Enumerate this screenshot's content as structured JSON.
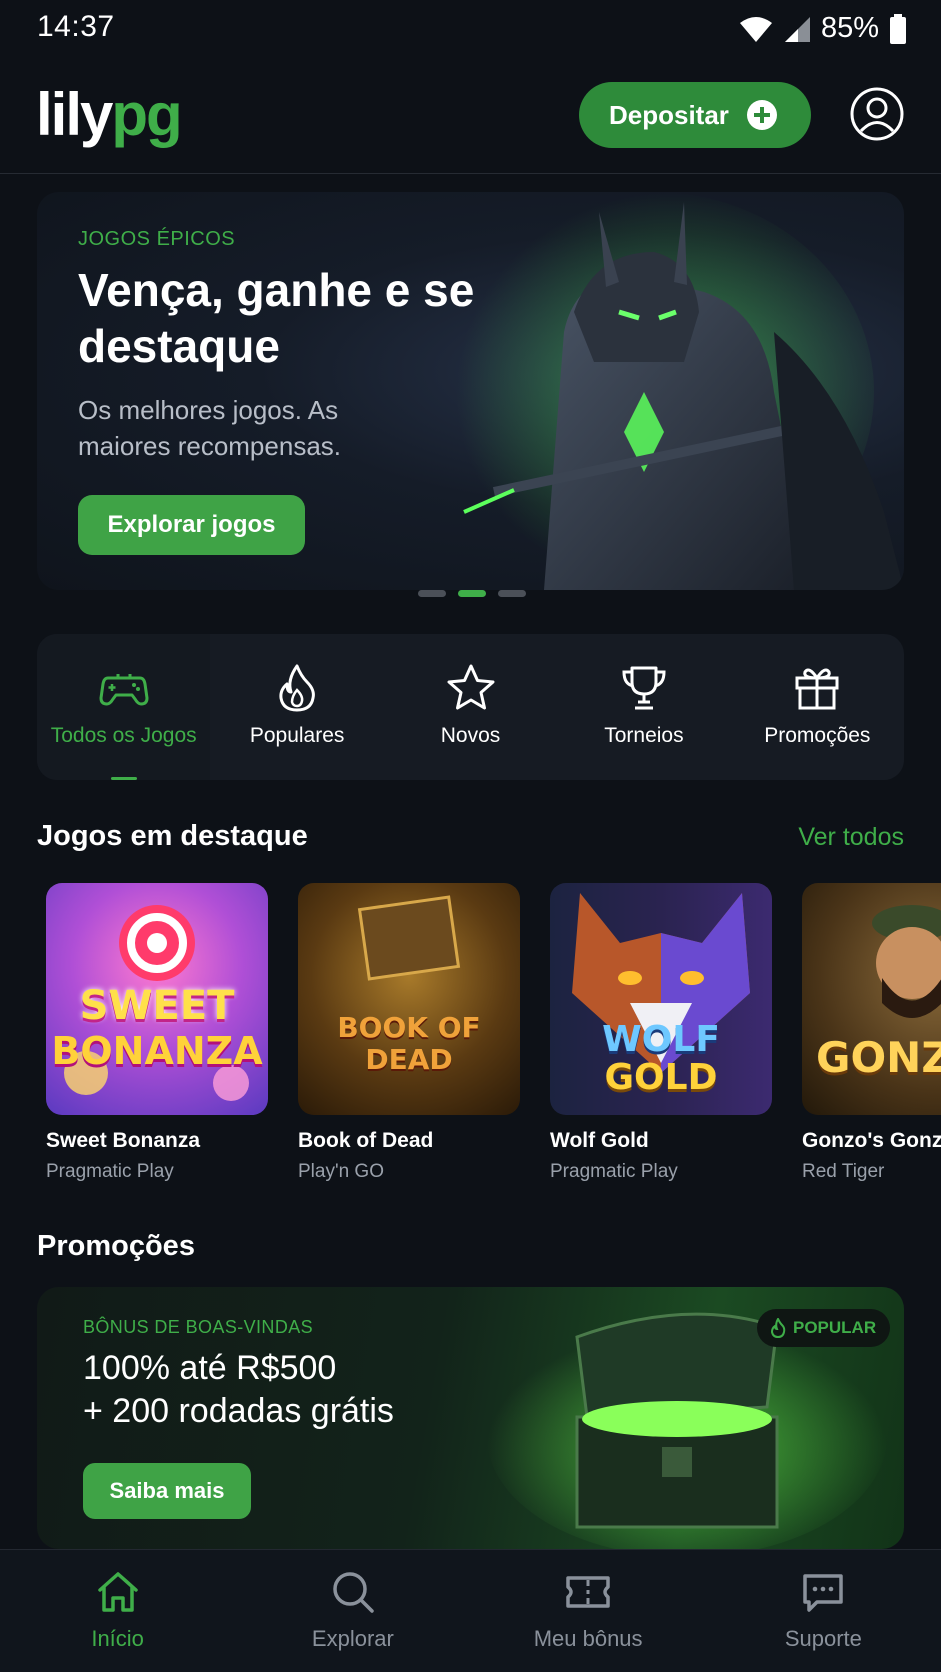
{
  "status_bar": {
    "time": "14:37",
    "battery": "85%"
  },
  "header": {
    "logo_part1": "lily",
    "logo_part2": "pg",
    "deposit_label": "Depositar"
  },
  "hero": {
    "kicker": "JOGOS ÉPICOS",
    "title": "Vença, ganhe e se destaque",
    "subtitle": "Os melhores jogos. As maiores recompensas.",
    "cta": "Explorar jogos",
    "active_slide": 2,
    "slide_count": 3
  },
  "categories": [
    {
      "label": "Todos os Jogos",
      "icon": "gamepad-icon",
      "active": true
    },
    {
      "label": "Populares",
      "icon": "flame-icon",
      "active": false
    },
    {
      "label": "Novos",
      "icon": "star-icon",
      "active": false
    },
    {
      "label": "Torneios",
      "icon": "trophy-icon",
      "active": false
    },
    {
      "label": "Promoções",
      "icon": "gift-icon",
      "active": false
    }
  ],
  "featured": {
    "title": "Jogos em destaque",
    "see_all": "Ver todos",
    "games": [
      {
        "name": "Sweet Bonanza",
        "provider": "Pragmatic Play",
        "art_line1": "SWEET",
        "art_line2": "BONANZA"
      },
      {
        "name": "Book of Dead",
        "provider": "Play'n GO",
        "art_line1": "BOOK OF",
        "art_line2": "DEAD"
      },
      {
        "name": "Wolf Gold",
        "provider": "Pragmatic Play",
        "art_line1": "WOLF",
        "art_line2": "GOLD"
      },
      {
        "name": "Gonzo's Gonzo",
        "provider": "Red Tiger",
        "art_line1": "GONZO",
        "art_line2": ""
      }
    ]
  },
  "promotions": {
    "title": "Promoções",
    "kicker": "BÔNUS DE BOAS-VINDAS",
    "headline_line1": "100% até R$500",
    "headline_line2": "+ 200 rodadas grátis",
    "cta": "Saiba mais",
    "badge": "POPULAR"
  },
  "bottom_nav": [
    {
      "label": "Início",
      "icon": "home-icon",
      "active": true
    },
    {
      "label": "Explorar",
      "icon": "search-icon",
      "active": false
    },
    {
      "label": "Meu bônus",
      "icon": "ticket-icon",
      "active": false
    },
    {
      "label": "Suporte",
      "icon": "chat-icon",
      "active": false
    }
  ],
  "colors": {
    "accent": "#3fae49",
    "background": "#0d1117",
    "card": "#161b23"
  }
}
